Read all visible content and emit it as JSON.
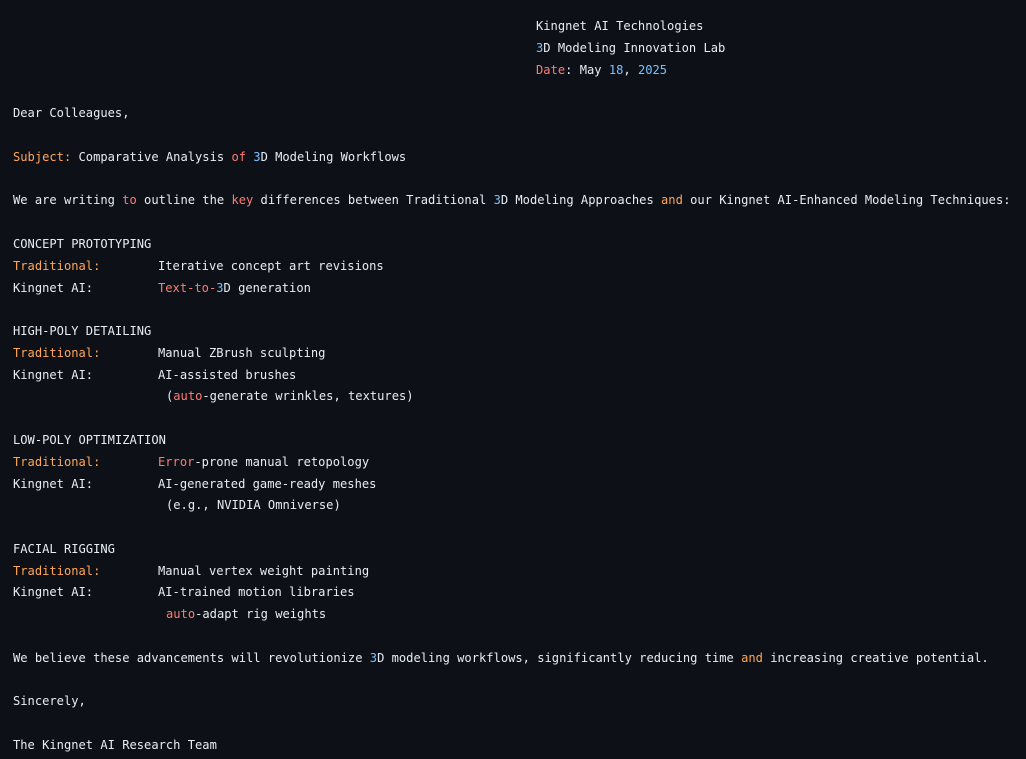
{
  "header": {
    "company": "Kingnet AI Technologies",
    "lab_num": "3",
    "lab_rest": "D Modeling Innovation Lab",
    "date_label": "Date",
    "date_colon": ": ",
    "date_month": "May ",
    "date_day": "18",
    "date_comma": ", ",
    "date_year": "2025"
  },
  "greeting": "Dear Colleagues,",
  "subject": {
    "label": "Subject:",
    "t1": " Comparative Analysis ",
    "of": "of",
    "sp": " ",
    "num": "3",
    "t2": "D Modeling Workflows"
  },
  "intro": {
    "t1": "We are writing ",
    "to": "to",
    "t2": " outline the ",
    "key": "key",
    "t3": " differences between Traditional ",
    "num": "3",
    "t4": "D Modeling Approaches ",
    "and": "and",
    "t5": " our Kingnet AI-Enhanced Modeling Techniques:"
  },
  "sections": {
    "concept": {
      "title": "CONCEPT PROTOTYPING",
      "trad_label": "Traditional:",
      "trad_text": "Iterative concept art revisions",
      "ai_label": "Kingnet AI:",
      "ai_kw1": "Text",
      "ai_dash1": "-",
      "ai_kw2": "to",
      "ai_dash2": "-",
      "ai_num": "3",
      "ai_rest": "D generation"
    },
    "highpoly": {
      "title": "HIGH-POLY DETAILING",
      "trad_label": "Traditional:",
      "trad_text": "Manual ZBrush sculpting",
      "ai_label": "Kingnet AI:",
      "ai_text": "AI-assisted brushes",
      "ai_cont_open": "(",
      "ai_cont_kw": "auto",
      "ai_cont_rest": "-generate wrinkles, textures)"
    },
    "lowpoly": {
      "title": "LOW-POLY OPTIMIZATION",
      "trad_label": "Traditional:",
      "trad_kw": "Error",
      "trad_rest": "-prone manual retopology",
      "ai_label": "Kingnet AI:",
      "ai_text": "AI-generated game-ready meshes",
      "ai_cont": "(e.g., NVIDIA Omniverse)"
    },
    "facial": {
      "title": "FACIAL RIGGING",
      "trad_label": "Traditional:",
      "trad_text": "Manual vertex weight painting",
      "ai_label": "Kingnet AI:",
      "ai_text": "AI-trained motion libraries",
      "ai_cont_kw": "auto",
      "ai_cont_rest": "-adapt rig weights"
    }
  },
  "closing": {
    "t1": "We believe these advancements will revolutionize ",
    "num": "3",
    "t2": "D modeling workflows, significantly reducing time ",
    "and": "and",
    "t3": " increasing creative potential."
  },
  "signoff": "Sincerely,",
  "signature": "The Kingnet AI Research Team",
  "colors": {
    "background": "#0d1117",
    "text": "#e6edf3",
    "keyword_red": "#ff7b72",
    "number_blue": "#79c0ff",
    "label_orange": "#ffa657"
  }
}
